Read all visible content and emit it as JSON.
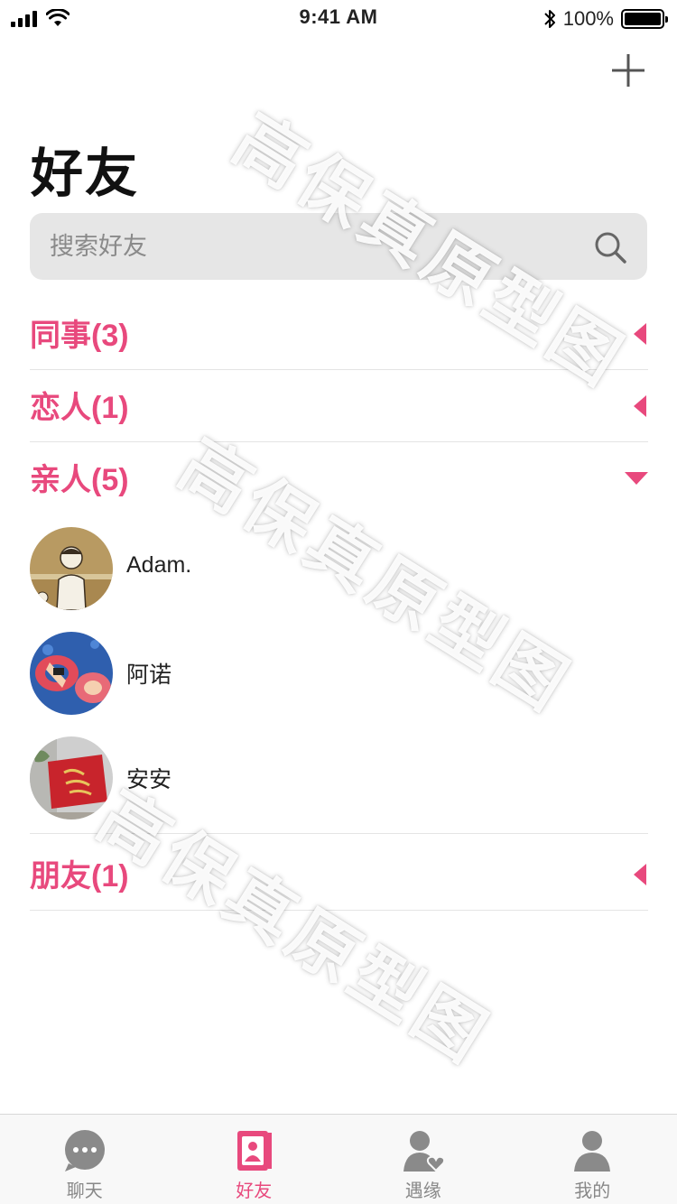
{
  "status_bar": {
    "time": "9:41 AM",
    "battery": "100%"
  },
  "header": {
    "title": "好友",
    "add_icon": "plus-icon"
  },
  "search": {
    "placeholder": "搜索好友",
    "value": ""
  },
  "groups": [
    {
      "label": "同事(3)",
      "expanded": false
    },
    {
      "label": "恋人(1)",
      "expanded": false
    },
    {
      "label": "亲人(5)",
      "expanded": true
    },
    {
      "label": "朋友(1)",
      "expanded": false
    }
  ],
  "friends": [
    {
      "name": "Adam."
    },
    {
      "name": "阿诺"
    },
    {
      "name": "安安"
    }
  ],
  "watermark": "高保真原型图",
  "tabs": [
    {
      "label": "聊天",
      "icon": "chat-icon",
      "active": false
    },
    {
      "label": "好友",
      "icon": "contacts-icon",
      "active": true
    },
    {
      "label": "遇缘",
      "icon": "person-heart-icon",
      "active": false
    },
    {
      "label": "我的",
      "icon": "profile-icon",
      "active": false
    }
  ],
  "colors": {
    "accent": "#e8497d",
    "inactive_tab": "#888888"
  }
}
